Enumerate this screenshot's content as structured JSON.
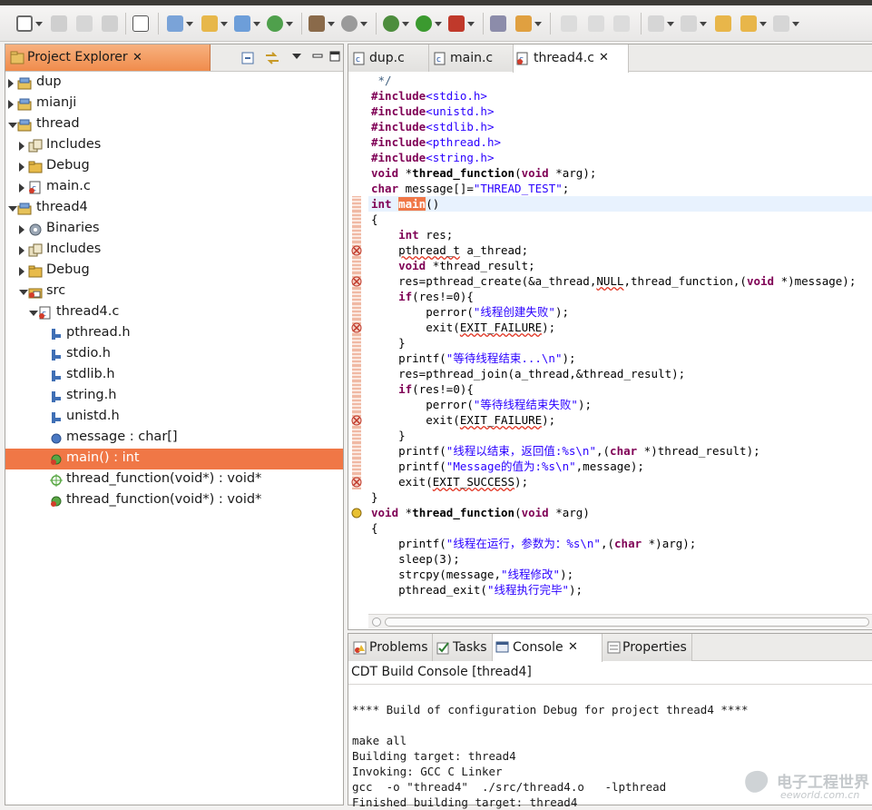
{
  "colors": {
    "selection": "#f07746",
    "keyword": "#7f0055",
    "string": "#2a00ff"
  },
  "project_explorer": {
    "title": "Project Explorer",
    "close": "✕",
    "tree": [
      {
        "label": "dup",
        "icon": "project-icon"
      },
      {
        "label": "mianji",
        "icon": "project-icon"
      },
      {
        "label": "thread",
        "icon": "project-icon"
      },
      {
        "label": "Includes",
        "icon": "includes-icon"
      },
      {
        "label": "Debug",
        "icon": "folder-icon"
      },
      {
        "label": "main.c",
        "icon": "c-file-icon"
      },
      {
        "label": "thread4",
        "icon": "project-icon"
      },
      {
        "label": "Binaries",
        "icon": "binaries-icon"
      },
      {
        "label": "Includes",
        "icon": "includes-icon"
      },
      {
        "label": "Debug",
        "icon": "folder-icon"
      },
      {
        "label": "src",
        "icon": "source-folder-icon"
      },
      {
        "label": "thread4.c",
        "icon": "c-file-icon"
      },
      {
        "label": "pthread.h",
        "icon": "header-icon"
      },
      {
        "label": "stdio.h",
        "icon": "header-icon"
      },
      {
        "label": "stdlib.h",
        "icon": "header-icon"
      },
      {
        "label": "string.h",
        "icon": "header-icon"
      },
      {
        "label": "unistd.h",
        "icon": "header-icon"
      },
      {
        "label": "message : char[]",
        "icon": "variable-icon"
      },
      {
        "label": "main() : int",
        "icon": "function-icon"
      },
      {
        "label": "thread_function(void*) : void*",
        "icon": "function-decl-icon"
      },
      {
        "label": "thread_function(void*) : void*",
        "icon": "function-icon"
      }
    ]
  },
  "editor": {
    "tabs": [
      {
        "label": "dup.c"
      },
      {
        "label": "main.c"
      },
      {
        "label": "thread4.c",
        "close": "✕"
      }
    ],
    "code": [
      " */",
      "#include<stdio.h>",
      "#include<unistd.h>",
      "#include<stdlib.h>",
      "#include<pthread.h>",
      "#include<string.h>",
      "void *thread_function(void *arg);",
      "char message[]=\"THREAD_TEST\";",
      "int main()",
      "{",
      "    int res;",
      "    pthread_t a_thread;",
      "    void *thread_result;",
      "    res=pthread_create(&a_thread,NULL,thread_function,(void *)message);",
      "    if(res!=0){",
      "        perror(\"线程创建失败\");",
      "        exit(EXIT_FAILURE);",
      "    }",
      "    printf(\"等待线程结束...\\n\");",
      "    res=pthread_join(a_thread,&thread_result);",
      "    if(res!=0){",
      "        perror(\"等待线程结束失败\");",
      "        exit(EXIT_FAILURE);",
      "    }",
      "    printf(\"线程以结束，返回值:%s\\n\",(char *)thread_result);",
      "    printf(\"Message的值为:%s\\n\",message);",
      "    exit(EXIT_SUCCESS);",
      "}",
      "void *thread_function(void *arg)",
      "{",
      "    printf(\"线程在运行，参数为：%s\\n\",(char *)arg);",
      "    sleep(3);",
      "    strcpy(message,\"线程修改\");",
      "    pthread_exit(\"线程执行完毕\");"
    ]
  },
  "console": {
    "tabs": [
      {
        "label": "Problems"
      },
      {
        "label": "Tasks"
      },
      {
        "label": "Console",
        "close": "✕"
      },
      {
        "label": "Properties"
      }
    ],
    "title": "CDT Build Console [thread4]",
    "lines": [
      "",
      "**** Build of configuration Debug for project thread4 ****",
      "",
      "make all",
      "Building target: thread4",
      "Invoking: GCC C Linker",
      "gcc  -o \"thread4\"  ./src/thread4.o   -lpthread",
      "Finished building target: thread4"
    ]
  },
  "watermark": {
    "cn": "电子工程世界",
    "en": "eeworld.com.cn"
  }
}
